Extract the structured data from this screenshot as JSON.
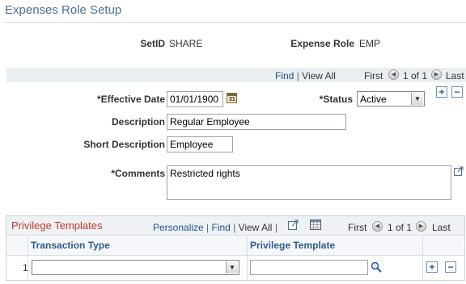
{
  "page": {
    "title": "Expenses Role Setup"
  },
  "header": {
    "setid_label": "SetID",
    "setid_value": "SHARE",
    "role_label": "Expense Role",
    "role_value": "EMP"
  },
  "effdt_nav": {
    "find": "Find",
    "sep": "|",
    "view_all": "View All",
    "first": "First",
    "count": "1 of 1",
    "last": "Last"
  },
  "form": {
    "effdt_label": "*Effective Date",
    "effdt_value": "01/01/1900",
    "status_label": "*Status",
    "status_value": "Active",
    "desc_label": "Description",
    "desc_value": "Regular Employee",
    "short_label": "Short Description",
    "short_value": "Employee",
    "comments_label": "*Comments",
    "comments_value": "Restricted rights"
  },
  "grid": {
    "title": "Privilege Templates",
    "personalize": "Personalize",
    "find": "Find",
    "view_all": "View All",
    "sep": "|",
    "first": "First",
    "count": "1 of 1",
    "last": "Last",
    "columns": [
      "Transaction Type",
      "Privilege Template"
    ],
    "rows": [
      {
        "num": "1",
        "transaction_type": "",
        "privilege_template": ""
      }
    ]
  },
  "colors": {
    "title": "#4a6f95",
    "link": "#23518e",
    "grid_title": "#c0392b"
  },
  "icons": {
    "calendar": "calendar-icon",
    "lookup": "magnifier-icon",
    "expand": "expand-window-icon"
  }
}
